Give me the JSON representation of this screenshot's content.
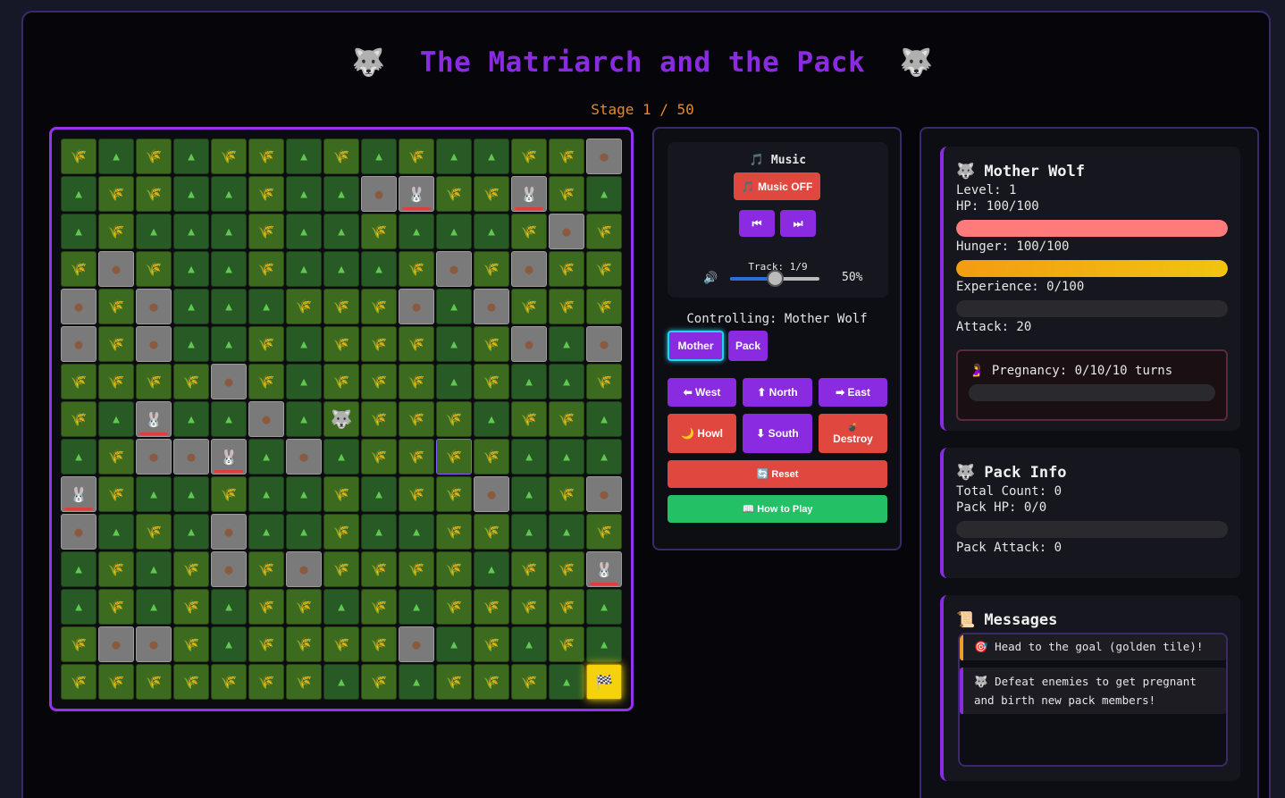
{
  "header": {
    "title_icon": "🐺",
    "title": "The Matriarch and the Pack",
    "stage": "Stage 1 / 50"
  },
  "board": {
    "rows": [
      "GTGTGGTGTGTTGGR",
      "TGGTTGTTRBGGBGT",
      "TGTTTGTTGTTTGRG",
      "GRGTTGTTTGRGRGG",
      "RGRTTTGGGRTRGGG",
      "RGRTTGTGGGTGRTR",
      "GGGGRGTGGGTGTTG",
      "GTBTTRTWGGGTGGT",
      "TGRRBTRTGGSGTTT",
      "BGTTGTTGTGGRTGR",
      "RTGTRTTGTTGGTTG",
      "TGTGRGRGGGGTGGB",
      "TGTGTGGTGTGGGGT",
      "GRRGTGGGGRTGTGT",
      "GGGGGGGTGTGGGTE"
    ],
    "legend": {
      "G": "grass",
      "T": "tree",
      "R": "rock",
      "B": "rabbit",
      "W": "mother-wolf",
      "S": "selected-grass",
      "E": "goal"
    },
    "icons": {
      "grass": "🌾",
      "tree": "▲",
      "rock": "●",
      "rabbit": "🐰",
      "wolf": "🐺",
      "goal": "🏁"
    }
  },
  "music": {
    "title": "🎵 Music",
    "toggle_label": "🎵 Music OFF",
    "prev_label": "⏮",
    "next_label": "⏭",
    "track": "Track: 1/9",
    "volume_icon": "🔊",
    "volume": 50,
    "volume_text": "50%"
  },
  "controls": {
    "controlling": "Controlling: Mother Wolf",
    "mother_label": "Mother",
    "pack_label": "Pack",
    "west_label": "⬅ West",
    "north_label": "⬆ North",
    "east_label": "➡ East",
    "howl_label": "🌙 Howl",
    "south_label": "⬇ South",
    "destroy_icon": "💣",
    "destroy_label": "Destroy",
    "reset_label": "🔄 Reset",
    "howto_label": "📖 How to Play"
  },
  "mother": {
    "icon": "🐺",
    "title": "Mother Wolf",
    "level": "Level: 1",
    "hp": "HP: 100/100",
    "hp_frac": 1,
    "hunger": "Hunger: 100/100",
    "hunger_frac": 1,
    "xp": "Experience: 0/100",
    "xp_frac": 0,
    "attack": "Attack: 20",
    "preg_icon": "🤰",
    "pregnancy": "Pregnancy: 0/10/10 turns",
    "preg_frac": 0
  },
  "pack": {
    "icon": "🐺",
    "title": "Pack Info",
    "count": "Total Count: 0",
    "hp": "Pack HP: 0/0",
    "hp_frac": 0,
    "attack": "Pack Attack: 0"
  },
  "messages": {
    "icon": "📜",
    "title": "Messages",
    "items": [
      {
        "text": "🎯 Head to the goal (golden tile)!"
      },
      {
        "text": "🐺 Defeat enemies to get pregnant and birth new pack members!"
      }
    ]
  },
  "colors": {
    "hp": "#ff7b7b",
    "hunger": "#f0a020",
    "accent": "#8a2be2",
    "goal": "#f5d20b"
  }
}
